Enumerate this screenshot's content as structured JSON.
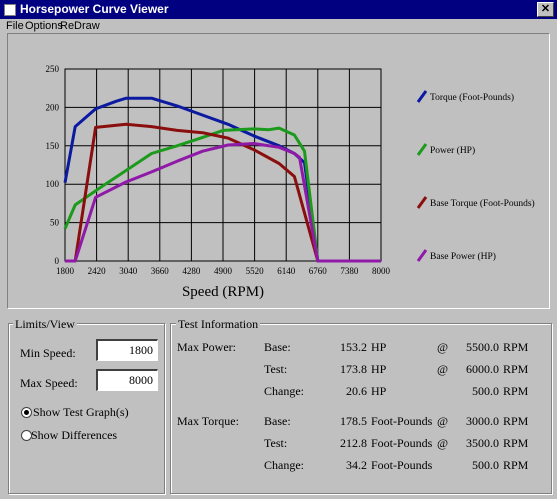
{
  "window": {
    "title": "Horsepower Curve Viewer",
    "close_glyph": "✕"
  },
  "menu": {
    "items": [
      "File",
      "Options",
      "ReDraw"
    ]
  },
  "colors": {
    "torque": "#0b1aa0",
    "power": "#1b9a1b",
    "base_torque": "#8b0e0e",
    "base_power": "#8f1aa8"
  },
  "chart_data": {
    "type": "line",
    "xlabel": "Speed (RPM)",
    "ylabel": "",
    "xlim": [
      1800,
      8000
    ],
    "ylim": [
      0,
      250
    ],
    "xticks": [
      1800,
      2420,
      3040,
      3660,
      4280,
      4900,
      5520,
      6140,
      6760,
      7380,
      8000
    ],
    "yticks": [
      0,
      50,
      100,
      150,
      200,
      250
    ],
    "grid": true,
    "legend_position": "right",
    "series": [
      {
        "name": "Torque (Foot-Pounds)",
        "color": "#0b1aa0",
        "points": [
          [
            1800,
            102
          ],
          [
            2000,
            175
          ],
          [
            2400,
            198
          ],
          [
            2800,
            208
          ],
          [
            3000,
            212
          ],
          [
            3500,
            212
          ],
          [
            4000,
            202
          ],
          [
            4500,
            190
          ],
          [
            5000,
            178
          ],
          [
            5500,
            163
          ],
          [
            6000,
            150
          ],
          [
            6300,
            140
          ],
          [
            6500,
            128
          ],
          [
            6760,
            0
          ],
          [
            8000,
            0
          ]
        ]
      },
      {
        "name": "Power (HP)",
        "color": "#1b9a1b",
        "points": [
          [
            1800,
            42
          ],
          [
            2000,
            73
          ],
          [
            2500,
            96
          ],
          [
            3000,
            118
          ],
          [
            3500,
            140
          ],
          [
            4000,
            150
          ],
          [
            4500,
            161
          ],
          [
            4900,
            170
          ],
          [
            5500,
            172
          ],
          [
            5800,
            171
          ],
          [
            6000,
            173
          ],
          [
            6300,
            164
          ],
          [
            6500,
            143
          ],
          [
            6760,
            0
          ],
          [
            8000,
            0
          ]
        ]
      },
      {
        "name": "Base Torque (Foot-Pounds)",
        "color": "#8b0e0e",
        "points": [
          [
            1800,
            0
          ],
          [
            2000,
            0
          ],
          [
            2400,
            174
          ],
          [
            3000,
            178
          ],
          [
            3500,
            175
          ],
          [
            4000,
            170
          ],
          [
            4500,
            167
          ],
          [
            5000,
            160
          ],
          [
            5500,
            145
          ],
          [
            6000,
            127
          ],
          [
            6300,
            110
          ],
          [
            6760,
            0
          ],
          [
            8000,
            0
          ]
        ]
      },
      {
        "name": "Base Power (HP)",
        "color": "#8f1aa8",
        "points": [
          [
            1800,
            0
          ],
          [
            2000,
            0
          ],
          [
            2400,
            83
          ],
          [
            3000,
            103
          ],
          [
            3500,
            116
          ],
          [
            4000,
            130
          ],
          [
            4500,
            143
          ],
          [
            5000,
            151
          ],
          [
            5500,
            153
          ],
          [
            6000,
            148
          ],
          [
            6300,
            140
          ],
          [
            6400,
            135
          ],
          [
            6760,
            0
          ],
          [
            8000,
            0
          ]
        ]
      }
    ]
  },
  "limits": {
    "title": "Limits/View",
    "min_label": "Min Speed:",
    "min_value": "1800",
    "max_label": "Max Speed:",
    "max_value": "8000",
    "opt_test": "Show Test Graph(s)",
    "opt_diff": "Show Differences"
  },
  "test": {
    "title": "Test Information",
    "max_power_label": "Max Power:",
    "max_torque_label": "Max Torque:",
    "power_rows": [
      {
        "label": "Base:",
        "value": "153.2",
        "unit": "HP",
        "at": "@",
        "rpm": "5500.0",
        "rpm_unit": "RPM"
      },
      {
        "label": "Test:",
        "value": "173.8",
        "unit": "HP",
        "at": "@",
        "rpm": "6000.0",
        "rpm_unit": "RPM"
      },
      {
        "label": "Change:",
        "value": "20.6",
        "unit": "HP",
        "at": "",
        "rpm": "500.0",
        "rpm_unit": "RPM"
      }
    ],
    "torque_rows": [
      {
        "label": "Base:",
        "value": "178.5",
        "unit": "Foot-Pounds",
        "at": "@",
        "rpm": "3000.0",
        "rpm_unit": "RPM"
      },
      {
        "label": "Test:",
        "value": "212.8",
        "unit": "Foot-Pounds",
        "at": "@",
        "rpm": "3500.0",
        "rpm_unit": "RPM"
      },
      {
        "label": "Change:",
        "value": "34.2",
        "unit": "Foot-Pounds",
        "at": "",
        "rpm": "500.0",
        "rpm_unit": "RPM"
      }
    ]
  }
}
